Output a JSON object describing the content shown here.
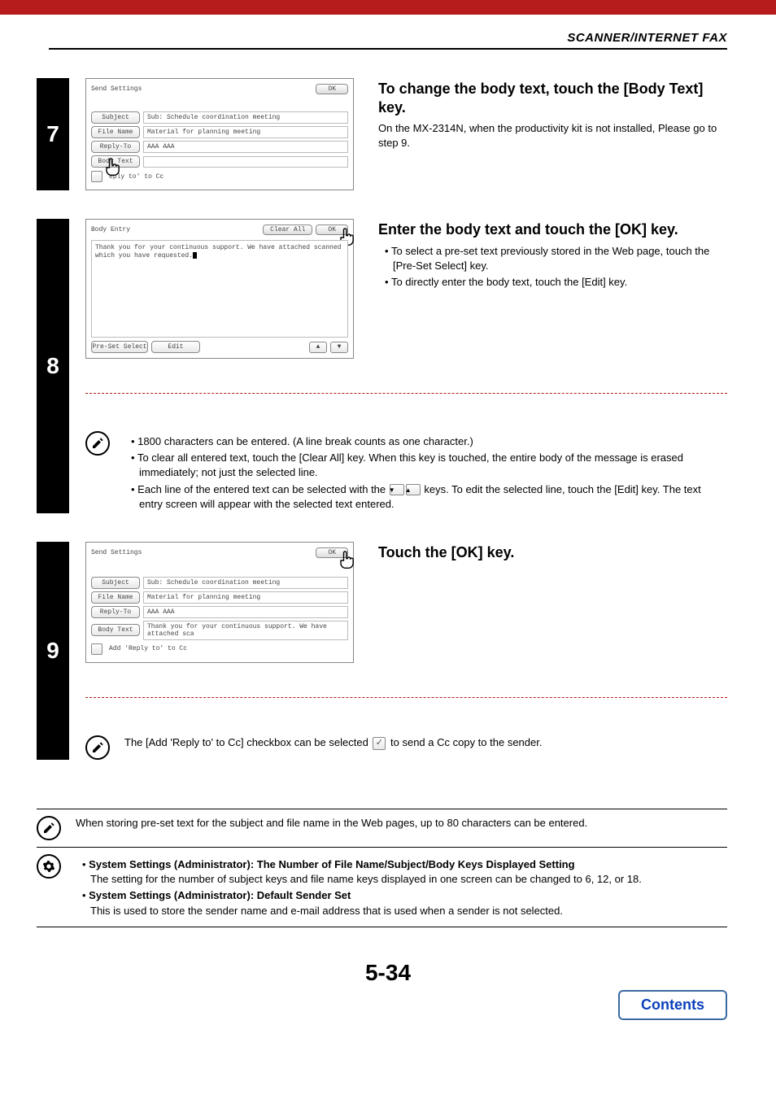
{
  "header": {
    "section_title": "SCANNER/INTERNET FAX"
  },
  "step7": {
    "number": "7",
    "heading": "To change the body text, touch the [Body Text] key.",
    "para": "On the MX-2314N, when the productivity kit is not installed, Please go to step 9.",
    "screen": {
      "title": "Send Settings",
      "ok": "OK",
      "subject_btn": "Subject",
      "subject_val": "Sub: Schedule coordination meeting",
      "filename_btn": "File Name",
      "filename_val": "Material for planning meeting",
      "replyto_btn": "Reply-To",
      "replyto_val": "AAA AAA",
      "bodytext_btn": "Body Text",
      "cc_label": "eply to' to Cc"
    }
  },
  "step8": {
    "number": "8",
    "heading": "Enter the body text and touch the [OK] key.",
    "bullets": [
      "To select a pre-set text previously stored in the Web page, touch the [Pre-Set Select] key.",
      "To directly enter the body text, touch the [Edit] key."
    ],
    "screen": {
      "title": "Body Entry",
      "clear_all": "Clear All",
      "ok": "OK",
      "body_line": "Thank you for your continuous support. We have attached scanned which you have requested.",
      "preset_btn": "Pre-Set Select",
      "edit_btn": "Edit"
    },
    "notes": [
      "1800 characters can be entered. (A line break counts as one character.)",
      "To clear all entered text, touch the [Clear All] key. When this key is touched, the entire body of the message is erased immediately; not just the selected line.",
      "Each line of the entered text can be selected with the ",
      " keys. To edit the selected line, touch the [Edit] key. The text entry screen will appear with the selected text entered."
    ]
  },
  "step9": {
    "number": "9",
    "heading": "Touch the [OK] key.",
    "screen": {
      "title": "Send Settings",
      "ok": "OK",
      "subject_btn": "Subject",
      "subject_val": "Sub: Schedule coordination meeting",
      "filename_btn": "File Name",
      "filename_val": "Material for planning meeting",
      "replyto_btn": "Reply-To",
      "replyto_val": "AAA AAA",
      "bodytext_btn": "Body Text",
      "bodytext_val": "Thank you for your continuous support. We have attached sca",
      "cc_label": "Add 'Reply to' to Cc"
    },
    "note_before": "The [Add 'Reply to' to Cc] checkbox can be selected ",
    "note_after": " to send a Cc copy to the sender."
  },
  "tips": {
    "pencil": "When storing pre-set text for the subject and file name in the Web pages, up to 80 characters can be entered.",
    "gear": [
      {
        "head": "System Settings (Administrator): The Number of File Name/Subject/Body Keys Displayed Setting",
        "body": "The setting for the number of subject keys and file name keys displayed in one screen can be changed to 6, 12, or 18."
      },
      {
        "head": "System Settings (Administrator): Default Sender Set",
        "body": "This is used to store the sender name and e-mail address that is used when a sender is not selected."
      }
    ]
  },
  "footer": {
    "page_number": "5-34",
    "contents": "Contents"
  }
}
